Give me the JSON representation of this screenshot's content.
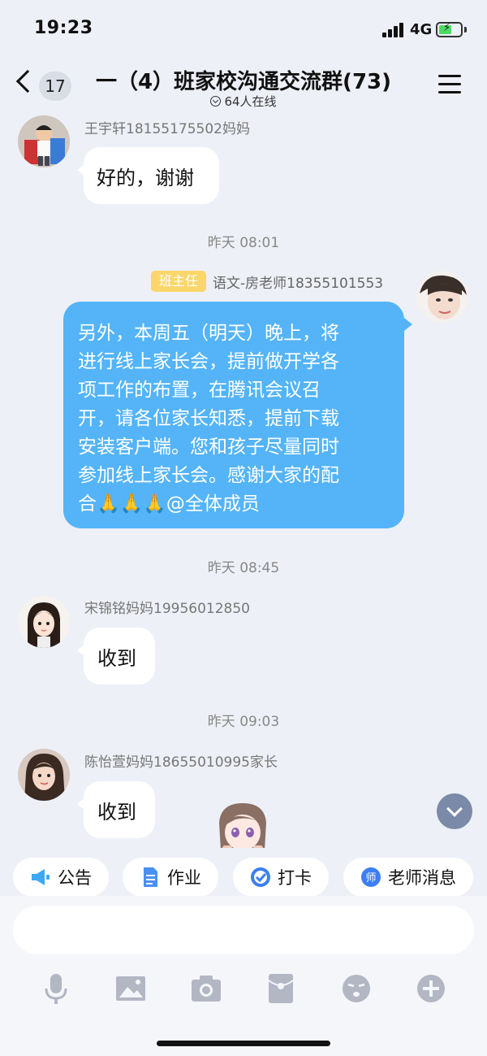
{
  "status_bar": {
    "time": "19:23",
    "network": "4G",
    "battery_level": 0.6
  },
  "header": {
    "unread_count": "17",
    "title": "一（4）班家校沟通交流群(73)",
    "online_text": "64人在线"
  },
  "messages": [
    {
      "sender": "王宇轩18155175502妈妈",
      "text": "好的，谢谢"
    },
    {
      "time": "昨天 08:01"
    },
    {
      "role_badge": "班主任",
      "sender": "语文-房老师18355101553",
      "lines": [
        "另外，本周五（明天）晚上，将",
        "进行线上家长会，提前做开学各",
        "项工作的布置，在腾讯会议召",
        "开，请各位家长知悉，提前下载",
        "安装客户端。您和孩子尽量同时",
        "参加线上家长会。感谢大家的配",
        "合🙏🙏🙏@全体成员"
      ]
    },
    {
      "time": "昨天 08:45"
    },
    {
      "sender": "宋锦铭妈妈19956012850",
      "text": "收到"
    },
    {
      "time": "昨天 09:03"
    },
    {
      "sender": "陈怡萱妈妈18655010995家长",
      "text": "收到"
    }
  ],
  "quick_actions": [
    "公告",
    "作业",
    "打卡",
    "老师消息"
  ],
  "input": {
    "placeholder": ""
  },
  "colors": {
    "mine_bubble": "#54b4f7",
    "badge": "#fbd66a",
    "background": "#eef0f7"
  },
  "toolbar_icons": [
    "microphone-icon",
    "image-icon",
    "camera-icon",
    "red-packet-icon",
    "emoji-icon",
    "plus-icon"
  ]
}
